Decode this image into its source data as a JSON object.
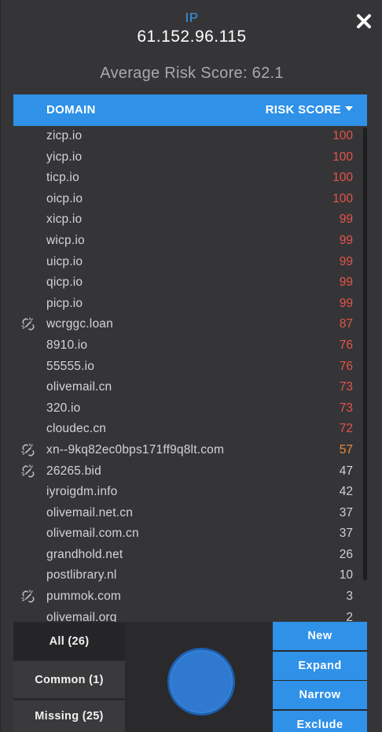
{
  "header": {
    "ip_label": "IP",
    "ip_value": "61.152.96.115",
    "average_label": "Average Risk Score: 62.1"
  },
  "table": {
    "col_domain": "DOMAIN",
    "col_risk": "RISK SCORE",
    "sort_icon": "caret-down-icon",
    "rows": [
      {
        "domain": "zicp.io",
        "score": "100",
        "flag": false,
        "color": "#e5544a"
      },
      {
        "domain": "yicp.io",
        "score": "100",
        "flag": false,
        "color": "#e5544a"
      },
      {
        "domain": "ticp.io",
        "score": "100",
        "flag": false,
        "color": "#e5544a"
      },
      {
        "domain": "oicp.io",
        "score": "100",
        "flag": false,
        "color": "#e5544a"
      },
      {
        "domain": "xicp.io",
        "score": "99",
        "flag": false,
        "color": "#e5544a"
      },
      {
        "domain": "wicp.io",
        "score": "99",
        "flag": false,
        "color": "#e5544a"
      },
      {
        "domain": "uicp.io",
        "score": "99",
        "flag": false,
        "color": "#e5544a"
      },
      {
        "domain": "qicp.io",
        "score": "99",
        "flag": false,
        "color": "#e5544a"
      },
      {
        "domain": "picp.io",
        "score": "99",
        "flag": false,
        "color": "#e5544a"
      },
      {
        "domain": "wcrggc.loan",
        "score": "87",
        "flag": true,
        "color": "#e5544a"
      },
      {
        "domain": "8910.io",
        "score": "76",
        "flag": false,
        "color": "#e5544a"
      },
      {
        "domain": "55555.io",
        "score": "76",
        "flag": false,
        "color": "#e5544a"
      },
      {
        "domain": "olivemail.cn",
        "score": "73",
        "flag": false,
        "color": "#e5544a"
      },
      {
        "domain": "320.io",
        "score": "73",
        "flag": false,
        "color": "#e5544a"
      },
      {
        "domain": "cloudec.cn",
        "score": "72",
        "flag": false,
        "color": "#e5544a"
      },
      {
        "domain": "xn--9kq82ec0bps171ff9q8lt.com",
        "score": "57",
        "flag": true,
        "color": "#e8893e"
      },
      {
        "domain": "26265.bid",
        "score": "47",
        "flag": true,
        "color": "#cfcfd1"
      },
      {
        "domain": "iyroigdm.info",
        "score": "42",
        "flag": false,
        "color": "#cfcfd1"
      },
      {
        "domain": "olivemail.net.cn",
        "score": "37",
        "flag": false,
        "color": "#cfcfd1"
      },
      {
        "domain": "olivemail.com.cn",
        "score": "37",
        "flag": false,
        "color": "#cfcfd1"
      },
      {
        "domain": "grandhold.net",
        "score": "26",
        "flag": false,
        "color": "#cfcfd1"
      },
      {
        "domain": "postlibrary.nl",
        "score": "10",
        "flag": false,
        "color": "#cfcfd1"
      },
      {
        "domain": "pummok.com",
        "score": "3",
        "flag": true,
        "color": "#cfcfd1"
      },
      {
        "domain": "olivemail.org",
        "score": "2",
        "flag": false,
        "color": "#cfcfd1"
      }
    ]
  },
  "filters": [
    {
      "label": "All (26)",
      "active": true
    },
    {
      "label": "Common (1)",
      "active": false
    },
    {
      "label": "Missing (25)",
      "active": false
    }
  ],
  "actions": [
    {
      "label": "New"
    },
    {
      "label": "Expand"
    },
    {
      "label": "Narrow"
    },
    {
      "label": "Exclude"
    }
  ],
  "colors": {
    "accent": "#2f91e8",
    "high_risk": "#e5544a",
    "medium_risk": "#e8893e"
  },
  "icons": {
    "close": "close-icon",
    "row_flag": "broken-link-icon",
    "action_circle": "circle-button"
  }
}
